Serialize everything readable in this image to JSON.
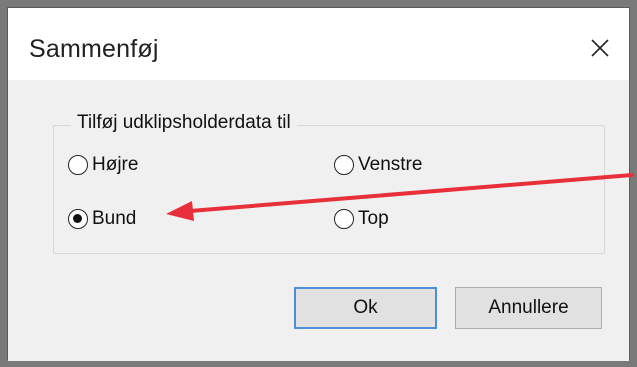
{
  "dialog": {
    "title": "Sammenføj",
    "close_icon": "close-icon"
  },
  "group": {
    "label": "Tilføj udklipsholderdata til",
    "options": [
      {
        "label": "Højre",
        "selected": false
      },
      {
        "label": "Venstre",
        "selected": false
      },
      {
        "label": "Bund",
        "selected": true
      },
      {
        "label": "Top",
        "selected": false
      }
    ]
  },
  "buttons": {
    "ok_label": "Ok",
    "cancel_label": "Annullere"
  },
  "colors": {
    "accent": "#4a90d9",
    "annotation_arrow": "#e8303a"
  }
}
